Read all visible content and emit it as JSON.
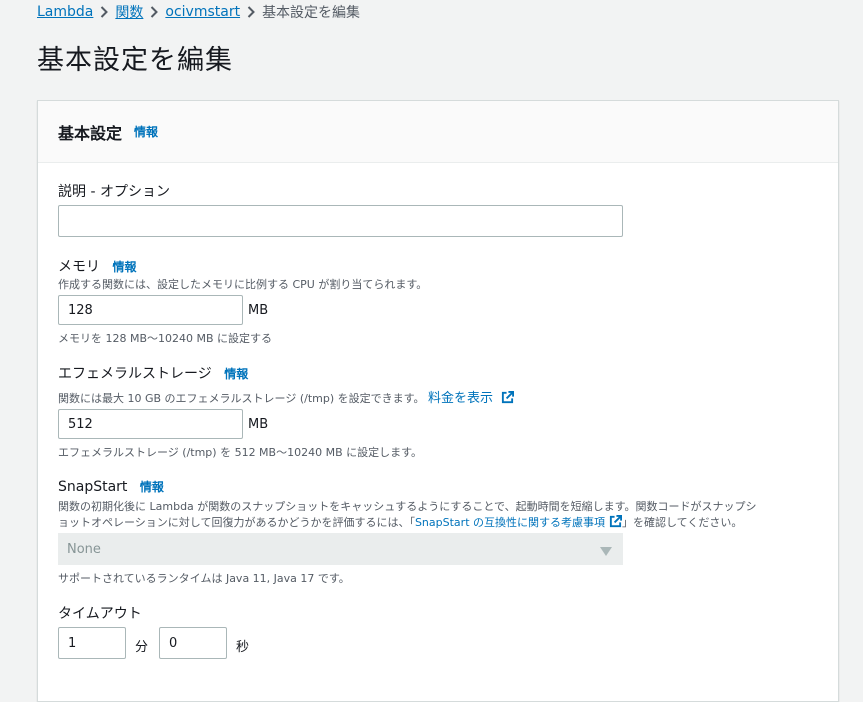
{
  "breadcrumb": {
    "items": [
      "Lambda",
      "関数",
      "ocivmstart"
    ],
    "current": "基本設定を編集"
  },
  "page": {
    "title": "基本設定を編集"
  },
  "panel": {
    "title": "基本設定",
    "info": "情報"
  },
  "description": {
    "label": "説明 - オプション",
    "value": ""
  },
  "memory": {
    "label": "メモリ",
    "info": "情報",
    "help": "作成する関数には、設定したメモリに比例する CPU が割り当てられます。",
    "value": "128",
    "unit": "MB",
    "constraint": "メモリを 128 MB〜10240 MB に設定する"
  },
  "ephemeral": {
    "label": "エフェメラルストレージ",
    "info": "情報",
    "help": "関数には最大 10 GB のエフェメラルストレージ (/tmp) を設定できます。",
    "pricing_link": "料金を表示",
    "value": "512",
    "unit": "MB",
    "constraint": "エフェメラルストレージ (/tmp) を 512 MB〜10240 MB に設定します。"
  },
  "snapstart": {
    "label": "SnapStart",
    "info": "情報",
    "help_line1": "関数の初期化後に Lambda が関数のスナップショットをキャッシュするようにすることで、起動時間を短縮します。関数コードがスナップシ",
    "help_line2_prefix": "ョットオペレーションに対して回復力があるかどうかを評価するには、「",
    "help_link": "SnapStart の互換性に関する考慮事項",
    "help_line2_suffix": "」を確認してください。",
    "selected": "None",
    "runtime_note": "サポートされているランタイムは Java 11, Java 17 です。"
  },
  "timeout": {
    "label": "タイムアウト",
    "minutes": "1",
    "minutes_unit": "分",
    "seconds": "0",
    "seconds_unit": "秒"
  },
  "colors": {
    "link": "#0073bb",
    "background": "#f2f3f3",
    "text": "#16191f"
  },
  "icons": [
    "chevron-right-icon",
    "external-link-icon",
    "caret-down-icon"
  ]
}
